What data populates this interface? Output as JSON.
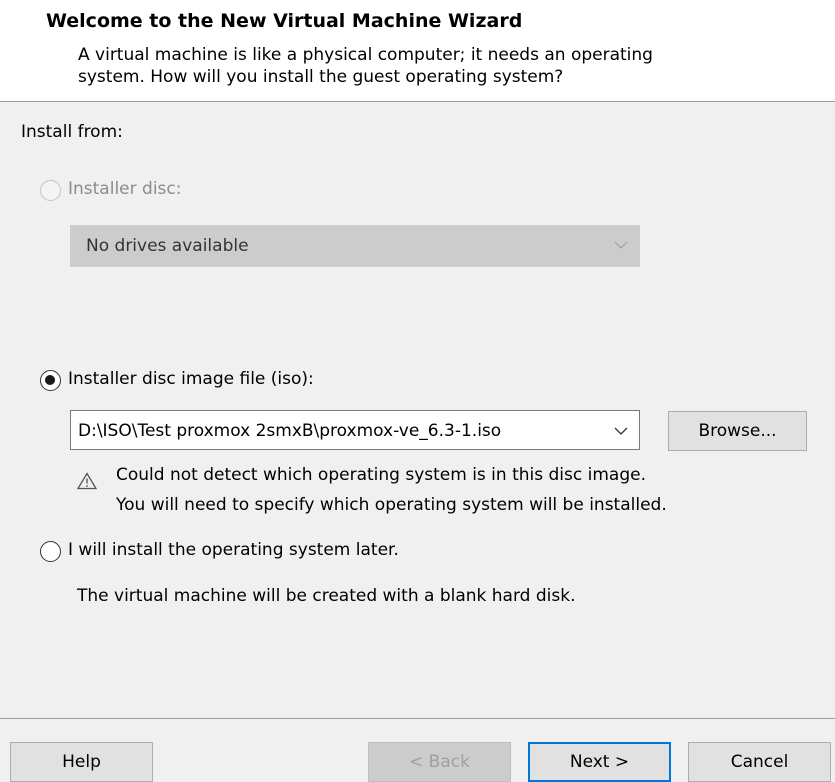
{
  "header": {
    "title": "Welcome to the New Virtual Machine Wizard",
    "subtitle_line1": "A virtual machine is like a physical computer; it needs an operating",
    "subtitle_line2": "system. How will you install the guest operating system?"
  },
  "install_from": {
    "label": "Install from:",
    "installer_disc": {
      "label": "Installer disc:",
      "selected": false,
      "enabled": false,
      "dropdown_value": "No drives available"
    },
    "iso": {
      "label": "Installer disc image file (iso):",
      "selected": true,
      "path": "D:\\ISO\\Test proxmox 2smxB\\proxmox-ve_6.3-1.iso",
      "browse_label": "Browse...",
      "warning_line1": "Could not detect which operating system is in this disc image.",
      "warning_line2": "You will need to specify which operating system will be installed."
    },
    "later": {
      "label": "I will install the operating system later.",
      "selected": false,
      "description": "The virtual machine will be created with a blank hard disk."
    }
  },
  "footer": {
    "help_label": "Help",
    "back_label": "< Back",
    "next_label": "Next >",
    "cancel_label": "Cancel"
  },
  "colors": {
    "accent": "#0078d7",
    "header_bg": "#ffffff",
    "body_bg": "#f0f0f0"
  }
}
